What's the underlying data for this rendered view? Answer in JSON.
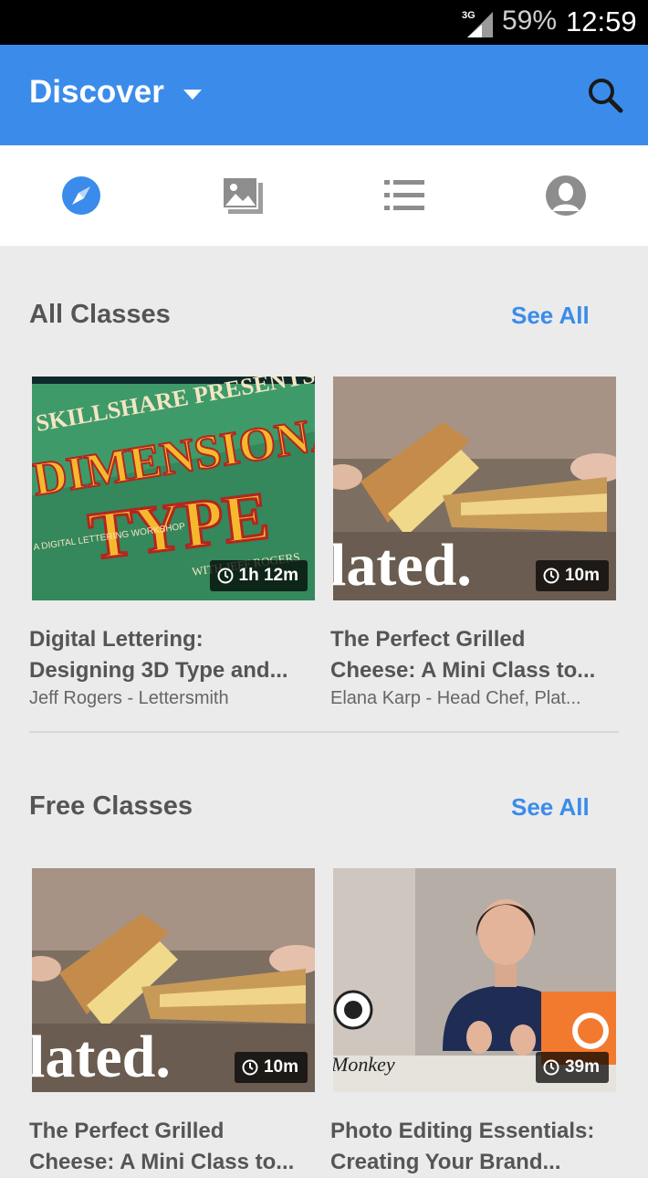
{
  "status_bar": {
    "network": "3G",
    "battery": "59%",
    "time": "12:59"
  },
  "app_bar": {
    "title": "Discover"
  },
  "tabs": [
    {
      "icon": "compass-icon"
    },
    {
      "icon": "gallery-icon"
    },
    {
      "icon": "list-icon"
    },
    {
      "icon": "profile-icon"
    }
  ],
  "sections": [
    {
      "title": "All Classes",
      "see_all": "See All",
      "cards": [
        {
          "title_line1": "Digital Lettering:",
          "title_line2": "Designing 3D Type and...",
          "subtitle": "Jeff Rogers - Lettersmith",
          "duration": "1h 12m"
        },
        {
          "title_line1": "The Perfect Grilled",
          "title_line2": "Cheese: A Mini Class to...",
          "subtitle": "Elana Karp - Head Chef, Plat...",
          "duration": "10m"
        }
      ]
    },
    {
      "title": "Free Classes",
      "see_all": "See All",
      "cards": [
        {
          "title_line1": "The Perfect Grilled",
          "title_line2": "Cheese: A Mini Class to...",
          "subtitle": "",
          "duration": "10m"
        },
        {
          "title_line1": "Photo Editing Essentials:",
          "title_line2": "Creating Your Brand...",
          "subtitle": "",
          "duration": "39m"
        }
      ]
    }
  ],
  "thumb_text": {
    "lettering_a": "SKILLSHARE PRESENTS",
    "lettering_b": "DIMENSIONAL",
    "lettering_c": "TYPE",
    "lettering_d": "A DIGITAL LETTERING WORKSHOP",
    "lettering_e": "WITH JEFF ROGERS",
    "plated": "lated.",
    "monkey": "Monkey"
  },
  "colors": {
    "accent": "#3b8cea",
    "statusbar": "#000000",
    "background": "#ebebeb"
  }
}
